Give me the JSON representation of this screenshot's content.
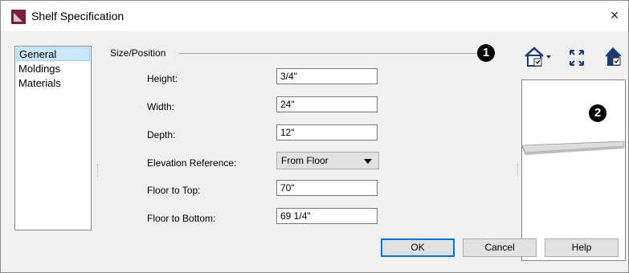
{
  "window": {
    "title": "Shelf Specification",
    "close_glyph": "×"
  },
  "nav": {
    "items": [
      {
        "label": "General",
        "selected": true
      },
      {
        "label": "Moldings",
        "selected": false
      },
      {
        "label": "Materials",
        "selected": false
      }
    ]
  },
  "size_position": {
    "group_label": "Size/Position",
    "fields": [
      {
        "label": "Height:",
        "value": "3/4\""
      },
      {
        "label": "Width:",
        "value": "24\""
      },
      {
        "label": "Depth:",
        "value": "12\""
      },
      {
        "label": "Elevation Reference:",
        "value": "From Floor"
      },
      {
        "label": "Floor to Top:",
        "value": "70\""
      },
      {
        "label": "Floor to Bottom:",
        "value": "69 1/4\""
      }
    ]
  },
  "callouts": [
    "1",
    "2"
  ],
  "preview_toolbar": {
    "icons": [
      "view-style-icon",
      "fill-window-icon",
      "preview-3d-icon"
    ]
  },
  "buttons": {
    "ok": "OK",
    "cancel": "Cancel",
    "help": "Help"
  },
  "colors": {
    "title_icon": "#7a1f3d",
    "selection": "#cce8ff",
    "accent_border": "#0078d7"
  }
}
